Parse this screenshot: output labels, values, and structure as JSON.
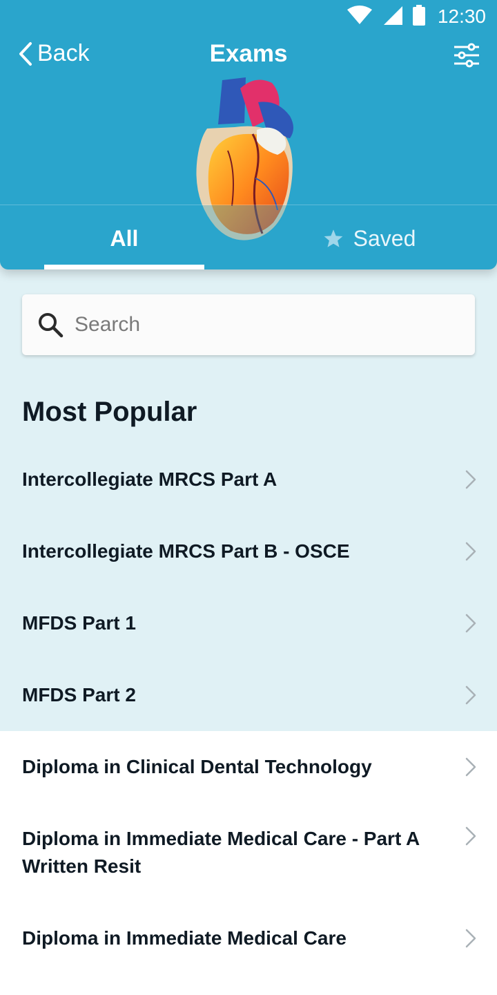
{
  "status_bar": {
    "time": "12:30"
  },
  "header": {
    "back_label": "Back",
    "title": "Exams",
    "background_color": "#2aa5cc"
  },
  "tabs": [
    {
      "label": "All",
      "selected": true
    },
    {
      "label": "Saved",
      "icon": "star-icon",
      "selected": false
    }
  ],
  "search": {
    "placeholder": "Search",
    "value": ""
  },
  "section": {
    "title": "Most Popular"
  },
  "exams": [
    {
      "label": "Intercollegiate MRCS Part A",
      "highlighted": true
    },
    {
      "label": "Intercollegiate MRCS Part B - OSCE",
      "highlighted": true
    },
    {
      "label": "MFDS Part 1",
      "highlighted": true
    },
    {
      "label": "MFDS Part 2",
      "highlighted": true
    },
    {
      "label": "Diploma in Clinical Dental Technology",
      "highlighted": false
    },
    {
      "label": "Diploma in Immediate Medical Care - Part A Written Resit",
      "highlighted": false
    },
    {
      "label": "Diploma in Immediate Medical Care",
      "highlighted": false
    }
  ],
  "colors": {
    "accent": "#2aa5cc",
    "popular_background": "#e0f1f5",
    "text": "#0f1a24"
  }
}
